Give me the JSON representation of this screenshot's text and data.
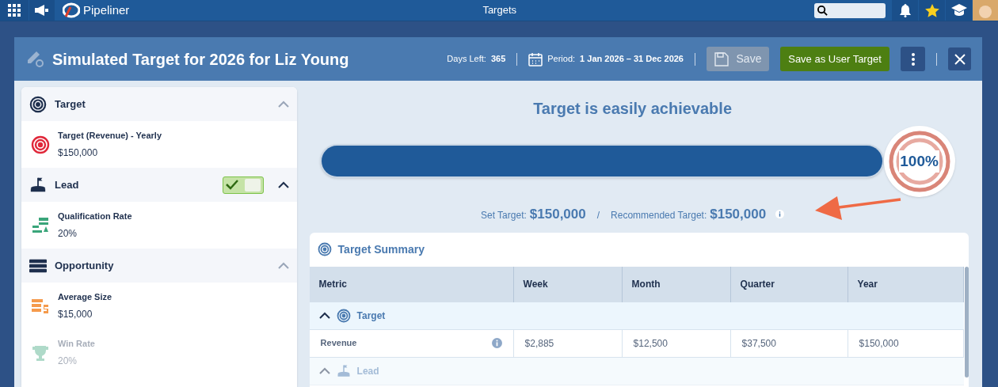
{
  "top_bar": {
    "brand": "Pipeliner",
    "title": "Targets"
  },
  "dialog": {
    "title": "Simulated Target for 2026 for Liz Young",
    "days_left_label": "Days Left:",
    "days_left": "365",
    "period_label": "Period:",
    "period": "1 Jan 2026 – 31 Dec 2026",
    "save": {
      "label": "Save",
      "disabled": true
    },
    "save_user_target": {
      "label": "Save as User Target",
      "disabled": false
    }
  },
  "sidebar": {
    "sections": [
      {
        "kind": "target",
        "title": "Target",
        "expanded": true,
        "items": [
          {
            "kind": "target",
            "label": "Target (Revenue) - Yearly",
            "value": "$150,000",
            "faded": false
          }
        ]
      },
      {
        "kind": "lead",
        "title": "Lead",
        "expanded": true,
        "toggle": {
          "on": true
        },
        "items": [
          {
            "kind": "qualification",
            "label": "Qualification Rate",
            "value": "20%",
            "faded": false
          }
        ]
      },
      {
        "kind": "opportunity",
        "title": "Opportunity",
        "expanded": true,
        "items": [
          {
            "kind": "size",
            "label": "Average Size",
            "value": "$15,000",
            "faded": false
          },
          {
            "kind": "winrate",
            "label": "Win Rate",
            "value": "20%",
            "faded": true
          }
        ]
      }
    ]
  },
  "status": {
    "headline": "Target is easily achievable",
    "level": 1,
    "percent": "100%",
    "set_target_label": "Set Target:",
    "set_target": "$150,000",
    "separator": "/",
    "recommended_label": "Recommended Target:",
    "recommended": "$150,000"
  },
  "summary": {
    "title": "Target Summary",
    "columns": [
      "Metric",
      "Week",
      "Month",
      "Quarter",
      "Year"
    ],
    "groups": [
      {
        "kind": "target",
        "title": "Target",
        "expanded": true,
        "faded": false,
        "rows": [
          {
            "metric": "Revenue",
            "values": [
              "$2,885",
              "$12,500",
              "$37,500",
              "$150,000"
            ]
          }
        ]
      },
      {
        "kind": "lead",
        "title": "Lead",
        "expanded": true,
        "faded": true
      }
    ]
  }
}
